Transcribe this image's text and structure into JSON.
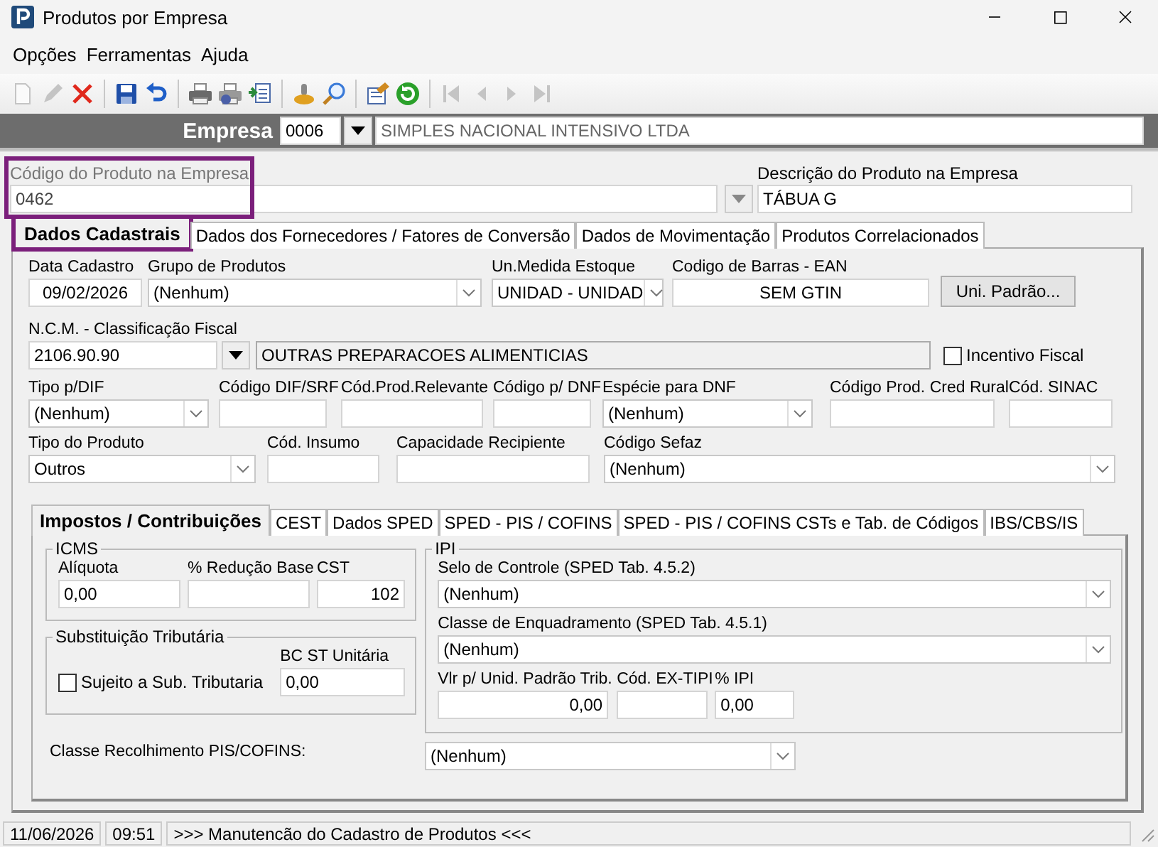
{
  "window": {
    "title": "Produtos por Empresa"
  },
  "menu": [
    "Opções",
    "Ferramentas",
    "Ajuda"
  ],
  "toolbar": [
    [
      {
        "kind": "new",
        "disabled": true
      },
      {
        "kind": "edit",
        "disabled": true
      },
      {
        "kind": "delete",
        "disabled": false
      }
    ],
    [
      {
        "kind": "save",
        "disabled": false
      },
      {
        "kind": "undo",
        "disabled": false
      }
    ],
    [
      {
        "kind": "print",
        "disabled": false
      },
      {
        "kind": "print-setup",
        "disabled": false
      },
      {
        "kind": "export",
        "disabled": false
      }
    ],
    [
      {
        "kind": "stamp",
        "disabled": false
      },
      {
        "kind": "search",
        "disabled": false
      }
    ],
    [
      {
        "kind": "properties",
        "disabled": false
      },
      {
        "kind": "refresh",
        "disabled": false
      }
    ],
    [
      {
        "kind": "first",
        "disabled": true
      },
      {
        "kind": "prev",
        "disabled": true
      },
      {
        "kind": "next",
        "disabled": true
      },
      {
        "kind": "last",
        "disabled": true
      }
    ]
  ],
  "empresa": {
    "label": "Empresa",
    "code": "0006",
    "name": "SIMPLES NACIONAL INTENSIVO LTDA"
  },
  "product": {
    "code_label": "Código do Produto na Empresa",
    "code": "0462",
    "highlighted": true,
    "description_label": "Descrição do Produto na Empresa",
    "description": "TÁBUA G"
  },
  "tabs": [
    {
      "label": "Dados Cadastrais",
      "selected": true,
      "highlighted": true
    },
    {
      "label": "Dados dos Fornecedores / Fatores de Conversão",
      "selected": false,
      "highlighted": false
    },
    {
      "label": "Dados de Movimentação",
      "selected": false,
      "highlighted": false
    },
    {
      "label": "Produtos Correlacionados",
      "selected": false,
      "highlighted": false
    }
  ],
  "form": {
    "rows": [
      {
        "fields": [
          {
            "kind": "text",
            "label": "Data Cadastro",
            "value": "09/02/2026"
          },
          {
            "kind": "combo",
            "label": "Grupo de Produtos",
            "value": "(Nenhum)"
          },
          {
            "kind": "combo",
            "label": "Un.Medida Estoque",
            "value": "UNIDAD - UNIDAD"
          },
          {
            "kind": "text",
            "label": "Codigo de Barras - EAN",
            "value": "SEM GTIN"
          },
          {
            "kind": "button",
            "value": "Uni. Padrão..."
          }
        ]
      },
      {
        "fields": [
          {
            "kind": "text",
            "label": "N.C.M. -  Classificação Fiscal",
            "value": "2106.90.90"
          },
          {
            "kind": "dropbutton"
          },
          {
            "kind": "readonly",
            "value": "OUTRAS PREPARACOES ALIMENTICIAS"
          },
          {
            "kind": "checkbox",
            "value": "Incentivo Fiscal",
            "checked": false
          }
        ]
      },
      {
        "fields": [
          {
            "kind": "combo",
            "label": "Tipo p/DIF",
            "value": "(Nenhum)"
          },
          {
            "kind": "text",
            "label": "Código DIF/SRF"
          },
          {
            "kind": "text",
            "label": "Cód.Prod.Relevante"
          },
          {
            "kind": "text",
            "label": "Código p/ DNF"
          },
          {
            "kind": "combo",
            "label": "Espécie para DNF",
            "value": "(Nenhum)"
          },
          {
            "kind": "text",
            "label": "Código Prod. Cred Rural"
          },
          {
            "kind": "text",
            "label": "Cód. SINAC"
          }
        ]
      },
      {
        "fields": [
          {
            "kind": "combo",
            "label": "Tipo do Produto",
            "value": "Outros"
          },
          {
            "kind": "text",
            "label": "Cód. Insumo"
          },
          {
            "kind": "text",
            "label": "Capacidade Recipiente"
          },
          {
            "kind": "combo",
            "label": "Código Sefaz",
            "value": "(Nenhum)"
          }
        ]
      }
    ]
  },
  "subtabs": [
    {
      "label": "Impostos / Contribuições",
      "selected": true
    },
    {
      "label": "CEST",
      "selected": false
    },
    {
      "label": "Dados SPED",
      "selected": false
    },
    {
      "label": "SPED - PIS / COFINS",
      "selected": false
    },
    {
      "label": "SPED - PIS / COFINS CSTs e Tab. de Códigos",
      "selected": false
    },
    {
      "label": "IBS/CBS/IS",
      "selected": false
    }
  ],
  "icms": {
    "title": "ICMS",
    "fields": [
      {
        "kind": "text",
        "label": "Alíquota",
        "value": "0,00"
      },
      {
        "kind": "text",
        "label": "% Redução Base"
      },
      {
        "kind": "text",
        "label": "CST",
        "value": "102"
      }
    ]
  },
  "st": {
    "title": "Substituição Tributária",
    "checkbox": {
      "label": "Sujeito a Sub. Tributaria",
      "checked": false
    },
    "field": {
      "kind": "text",
      "label": "BC ST Unitária",
      "value": "0,00"
    }
  },
  "ipi": {
    "title": "IPI",
    "fields": [
      {
        "kind": "combo",
        "label": "Selo de Controle (SPED Tab. 4.5.2)",
        "value": "(Nenhum)"
      },
      {
        "kind": "combo",
        "label": "Classe de Enquadramento (SPED Tab. 4.5.1)",
        "value": "(Nenhum)"
      },
      {
        "kind": "text",
        "label": "Vlr p/ Unid. Padrão Trib.",
        "value": "0,00"
      },
      {
        "kind": "text",
        "label": "Cód. EX-TIPI"
      },
      {
        "kind": "text",
        "label": "% IPI",
        "value": "0,00"
      }
    ]
  },
  "pis_cofins": {
    "label": "Classe Recolhimento PIS/COFINS:",
    "value": "(Nenhum)"
  },
  "status_bar": [
    "11/06/2026",
    "09:51",
    ">>> Manutencão do Cadastro de Produtos <<<"
  ]
}
